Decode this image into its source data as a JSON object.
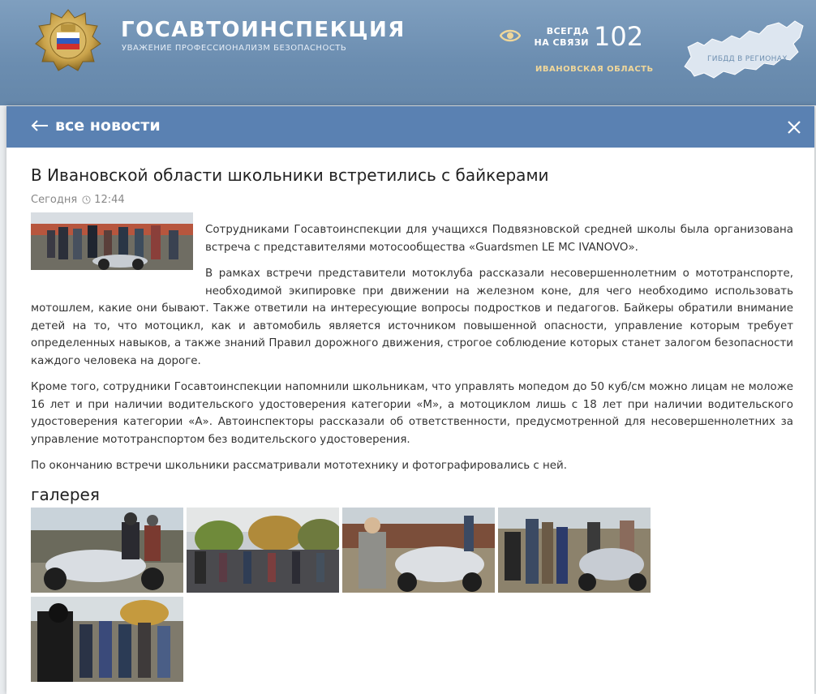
{
  "header": {
    "title": "ГОСАВТОИНСПЕКЦИЯ",
    "slogan": "УВАЖЕНИЕ ПРОФЕССИОНАЛИЗМ БЕЗОПАСНОСТЬ",
    "always_line1": "ВСЕГДА",
    "always_line2": "НА СВЯЗИ",
    "phone": "102",
    "region": "ИВАНОВСКАЯ ОБЛАСТЬ",
    "map_label": "ГИБДД В РЕГИОНАХ"
  },
  "panel": {
    "back_label": "все новости",
    "close_icon": "close-icon"
  },
  "news": {
    "title": "В Ивановской области школьники встретились с байкерами",
    "date": "Сегодня",
    "time": "12:44",
    "paragraphs": [
      "Сотрудниками Госавтоинспекции для учащихся Подвязновской средней школы была организована встреча с представителями мотосообщества «Guardsmen LE MC IVANOVO».",
      "В рамках встречи представители мотоклуба рассказали несовершеннолетним о мототранспорте, необходимой экипировке при движении на железном коне, для чего необходимо использовать мотошлем, какие они бывают. Также ответили на интересующие вопросы подростков и педагогов. Байкеры обратили внимание детей на то, что мотоцикл, как и автомобиль является источником повышенной опасности, управление которым требует определенных навыков, а также знаний Правил дорожного движения, строгое соблюдение которых станет залогом безопасности каждого человека на дороге.",
      "Кроме того, сотрудники Госавтоинспекции напомнили школьникам, что управлять мопедом до 50 куб/см можно лицам не моложе 16 лет и при наличии водительского удостоверения категории «М», а мотоциклом лишь с 18 лет при наличии водительского удостоверения категории «А». Автоинспекторы рассказали об ответственности, предусмотренной для несовершеннолетних за управление мототранспортом без водительского удостоверения.",
      "По окончанию встречи школьники рассматривали мототехнику и фотографировались с ней."
    ]
  },
  "gallery": {
    "title": "галерея"
  },
  "colors": {
    "header_bg": "#6b8db0",
    "topbar_bg": "#5a81b2",
    "region_text": "#f0d79a"
  }
}
